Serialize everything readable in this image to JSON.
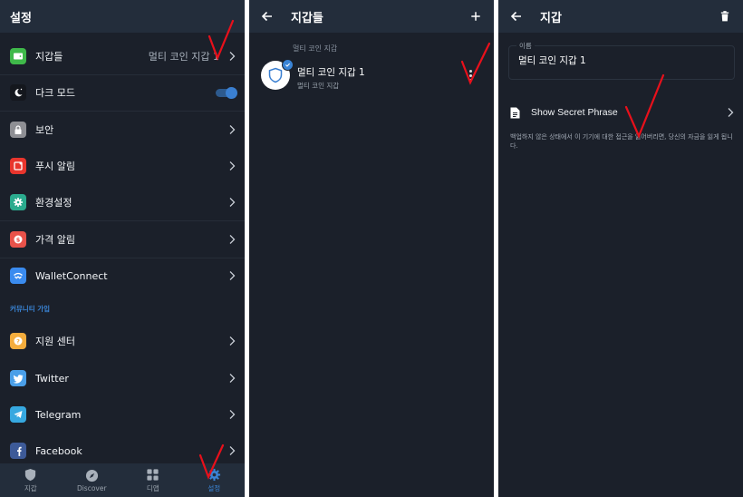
{
  "colors": {
    "accent": "#3a84d6",
    "background": "#1b202a",
    "header": "#232d3b",
    "annotation": "#e8101b"
  },
  "settings": {
    "title": "설정",
    "items": [
      {
        "label": "지갑들",
        "value": "멀티 코인 지갑 1",
        "icon": "wallet-icon",
        "icon_color": "#3fb94a"
      },
      {
        "label": "다크 모드",
        "toggle": true,
        "icon": "moon-icon"
      },
      {
        "label": "보안",
        "icon": "lock-icon",
        "icon_color": "#8e8f94"
      },
      {
        "label": "푸시 알림",
        "icon": "notification-icon",
        "icon_color": "#e8352d"
      },
      {
        "label": "환경설정",
        "icon": "gear-icon",
        "icon_color": "#2bab8e"
      },
      {
        "label": "가격 알림",
        "icon": "dollar-icon",
        "icon_color": "#e8524a"
      },
      {
        "label": "WalletConnect",
        "icon": "walletconnect-icon",
        "icon_color": "#3a8bef"
      }
    ],
    "community_section": "커뮤니티 가입",
    "community_items": [
      {
        "label": "지원 센터",
        "icon": "help-icon",
        "icon_color": "#f4ad3d"
      },
      {
        "label": "Twitter",
        "icon": "twitter-icon",
        "icon_color": "#4a9fe8"
      },
      {
        "label": "Telegram",
        "icon": "telegram-icon",
        "icon_color": "#36a8e0"
      },
      {
        "label": "Facebook",
        "icon": "facebook-icon",
        "icon_color": "#3d5a98"
      }
    ],
    "tabbar": [
      {
        "label": "지갑",
        "icon": "shield-icon",
        "active": false
      },
      {
        "label": "Discover",
        "icon": "compass-icon",
        "active": false
      },
      {
        "label": "디앱",
        "icon": "grid-icon",
        "active": false
      },
      {
        "label": "설정",
        "icon": "gear-icon",
        "active": true
      }
    ]
  },
  "wallets": {
    "title": "지갑들",
    "group_label": "멀티 코인 지갑",
    "wallet": {
      "name": "멀티 코인 지갑 1",
      "type": "멀티 코인 지갑",
      "selected": true
    }
  },
  "wallet_detail": {
    "title": "지갑",
    "name_label": "이름",
    "name_value": "멀티 코인 지갑 1",
    "secret_label": "Show Secret Phrase",
    "warning": "백업하지 않은 상태에서 이 기기에 대한 접근을 잃어버리면, 당신의 자금을 잃게 됩니다."
  }
}
